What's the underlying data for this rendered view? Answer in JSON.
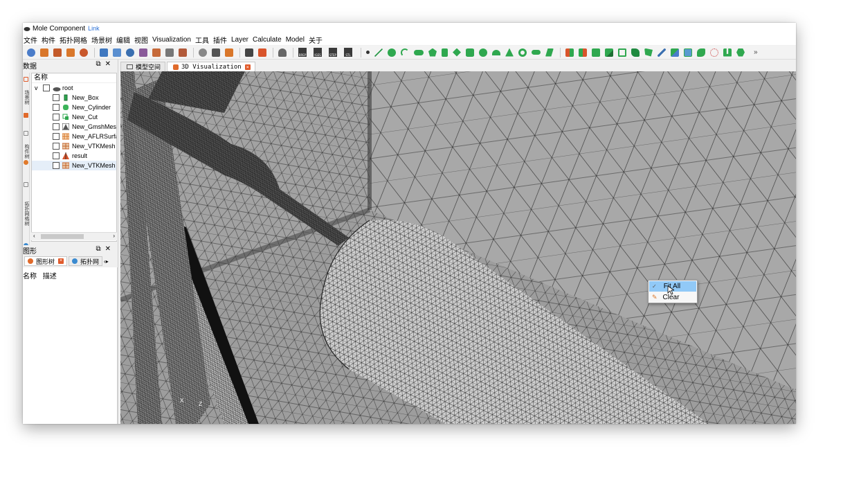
{
  "window": {
    "title": "Mole Component",
    "title_link": "Link"
  },
  "menu": [
    "文件",
    "构件",
    "拓扑网格",
    "场景树",
    "编辑",
    "视图",
    "Visualization",
    "工具",
    "插件",
    "Layer",
    "Calculate",
    "Model",
    "关于"
  ],
  "toolbar": {
    "file_buttons": [
      "BREP",
      "IGES",
      "STEP",
      "STL"
    ],
    "more": "»"
  },
  "data_panel": {
    "title": "数据",
    "header": "名称",
    "side_tabs": [
      "场景树",
      "构件树",
      "拓扑网格树"
    ],
    "tree": [
      {
        "label": "root",
        "level": 0,
        "icon": "root-icon"
      },
      {
        "label": "New_Box",
        "level": 1,
        "icon": "box-icon"
      },
      {
        "label": "New_Cylinder",
        "level": 1,
        "icon": "cylinder-icon"
      },
      {
        "label": "New_Cut",
        "level": 1,
        "icon": "cut-icon"
      },
      {
        "label": "New_GmshMes",
        "level": 1,
        "icon": "gmsh-mesh-icon"
      },
      {
        "label": "New_AFLRSurfa",
        "level": 1,
        "icon": "aflr-surface-icon"
      },
      {
        "label": "New_VTKMesh",
        "level": 1,
        "icon": "vtk-mesh-icon"
      },
      {
        "label": "result",
        "level": 1,
        "icon": "result-icon"
      },
      {
        "label": "New_VTKMesh",
        "level": 1,
        "icon": "vtk-mesh-icon"
      }
    ]
  },
  "graphics_panel": {
    "title": "图形",
    "tabs": [
      "图形树",
      "拓扑网"
    ],
    "columns": [
      "名称",
      "描述"
    ]
  },
  "doc_tabs": [
    "模型空间",
    "3D Visualization"
  ],
  "context_menu": [
    {
      "label": "Fit All",
      "icon": "check-icon",
      "highlighted": true
    },
    {
      "label": "Clear",
      "icon": "broom-icon",
      "highlighted": false
    }
  ],
  "axis_labels": {
    "x": "X",
    "z": "Z"
  },
  "colors": {
    "mesh_background": "#a9a9a9",
    "mesh_line": "#222222",
    "menu_highlight": "#91c9f7",
    "close_button": "#e05a2b"
  }
}
